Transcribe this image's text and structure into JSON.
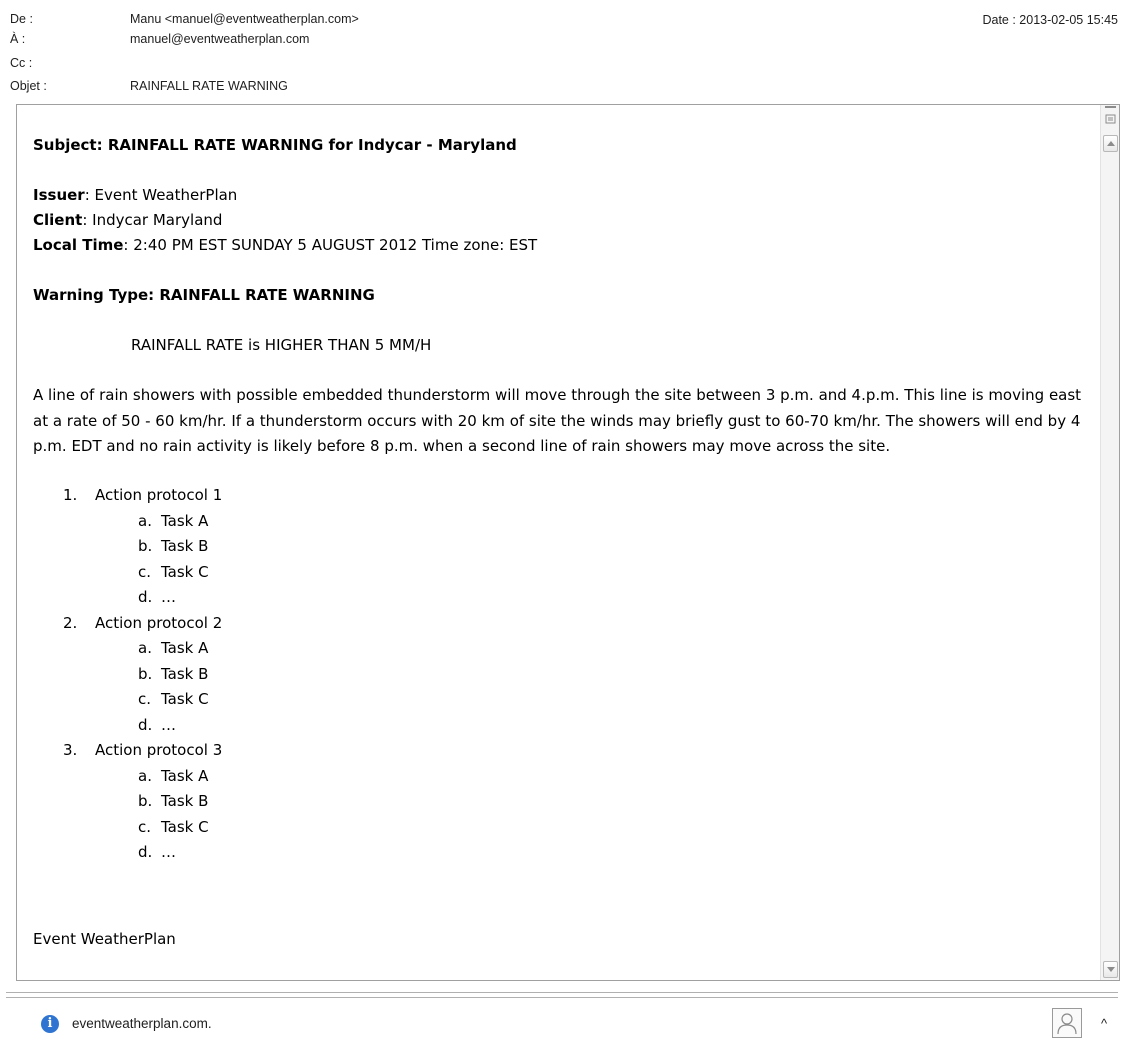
{
  "header": {
    "from_label": "De :",
    "from_value": "Manu <manuel@eventweatherplan.com>",
    "to_label": "À :",
    "to_value": "manuel@eventweatherplan.com",
    "cc_label": "Cc :",
    "cc_value": "",
    "subject_label": "Objet :",
    "subject_value": "RAINFALL RATE WARNING",
    "date": "Date : 2013-02-05 15:45"
  },
  "message": {
    "subject_line": "Subject: RAINFALL RATE WARNING for Indycar - Maryland",
    "issuer_label": "Issuer",
    "issuer_value": ": Event WeatherPlan",
    "client_label": "Client",
    "client_value": ": Indycar Maryland",
    "local_time_label": "Local Time",
    "local_time_value": ": 2:40 PM EST SUNDAY 5 AUGUST 2012 Time zone: EST",
    "warning_type": "Warning Type: RAINFALL RATE WARNING",
    "rate_line": "RAINFALL RATE is HIGHER THAN 5 MM/H",
    "paragraph": "A line of rain showers with possible embedded thunderstorm will move through the site between 3 p.m. and 4.p.m.  This line is moving east at a rate of 50 - 60 km/hr. If a thunderstorm occurs with 20 km of site the winds may briefly gust to 60-70 km/hr.  The showers will end by 4 p.m. EDT and no rain activity is likely before 8 p.m. when a second line of rain showers may move across the site.",
    "protocols": [
      {
        "num": "1.",
        "label": "Action protocol 1",
        "tasks": [
          {
            "m": "a.",
            "t": "Task A"
          },
          {
            "m": "b.",
            "t": "Task B"
          },
          {
            "m": "c.",
            "t": "Task C"
          },
          {
            "m": "d.",
            "t": "…"
          }
        ]
      },
      {
        "num": "2.",
        "label": "Action protocol 2",
        "tasks": [
          {
            "m": "a.",
            "t": "Task A"
          },
          {
            "m": "b.",
            "t": "Task B"
          },
          {
            "m": "c.",
            "t": "Task C"
          },
          {
            "m": "d.",
            "t": "…"
          }
        ]
      },
      {
        "num": "3.",
        "label": "Action protocol 3",
        "tasks": [
          {
            "m": "a.",
            "t": "Task A"
          },
          {
            "m": "b.",
            "t": "Task B"
          },
          {
            "m": "c.",
            "t": "Task C"
          },
          {
            "m": "d.",
            "t": "…"
          }
        ]
      }
    ],
    "signature": "Event WeatherPlan"
  },
  "footer": {
    "info_text": "eventweatherplan.com.",
    "caret": "^"
  },
  "icons": {
    "info": "info-icon",
    "avatar": "person-avatar-icon",
    "expand": "caret-up-icon",
    "scroll_up": "scroll-up-arrow-icon",
    "scroll_down": "scroll-down-arrow-icon"
  },
  "colors": {
    "info_icon": "#2f74d0",
    "border": "#a0a0a0"
  }
}
